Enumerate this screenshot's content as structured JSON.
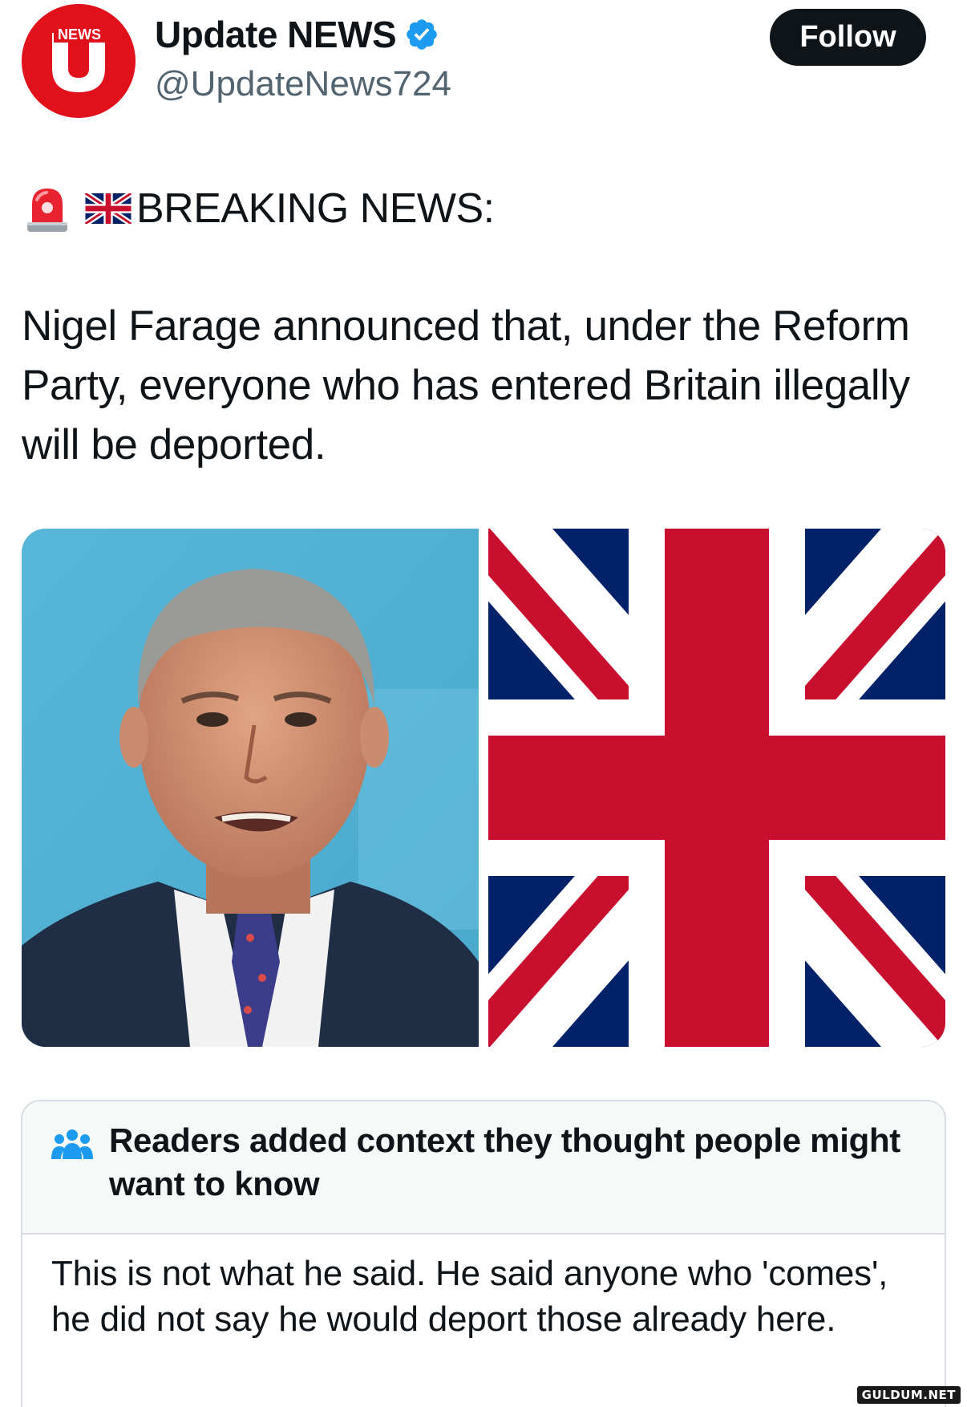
{
  "author": {
    "name": "Update NEWS",
    "handle": "@UpdateNews724",
    "avatar_badge": "NEWS",
    "avatar_letter": "U",
    "verified_icon": "verified-badge-icon",
    "avatar_color": "#e0111b"
  },
  "follow_button": {
    "label": "Follow"
  },
  "tweet": {
    "breaking_label": "BREAKING NEWS:",
    "breaking_icons": [
      "siren-icon",
      "uk-flag-icon"
    ],
    "body": "Nigel Farage announced that, under the Reform Party, everyone who has entered Britain illegally will be deported."
  },
  "media": {
    "items": [
      "photo-of-man-speaking",
      "union-jack-flag"
    ]
  },
  "community_note": {
    "title": "Readers added context they thought people might want to know",
    "icon": "people-group-icon",
    "text": "This is not what he said. He said anyone who 'comes', he did not say he would deport those already here."
  },
  "watermark": "GULDUM.NET",
  "colors": {
    "accent": "#1d9bf0",
    "text": "#0f1419",
    "secondary": "#536471",
    "flag_blue": "#012169",
    "flag_red": "#c8102e"
  }
}
